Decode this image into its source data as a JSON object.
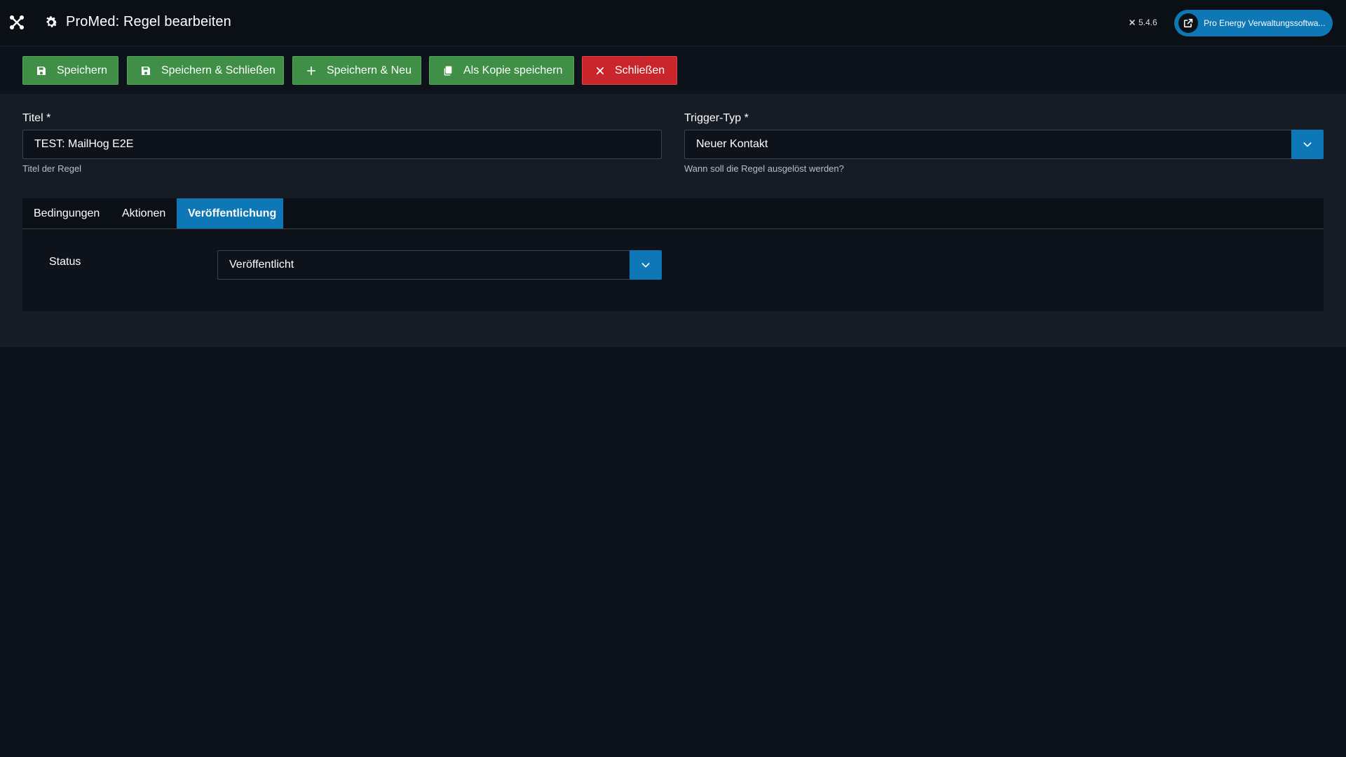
{
  "header": {
    "title": "ProMed: Regel bearbeiten",
    "version": "5.4.6",
    "site_button_label": "Pro Energy Verwaltungssoftwa..."
  },
  "toolbar": {
    "save_label": "Speichern",
    "save_close_label": "Speichern & Schließen",
    "save_new_label": "Speichern & Neu",
    "save_copy_label": "Als Kopie speichern",
    "close_label": "Schließen"
  },
  "form": {
    "title_label": "Titel *",
    "title_value": "TEST: MailHog E2E",
    "title_help": "Titel der Regel",
    "trigger_label": "Trigger-Typ *",
    "trigger_value": "Neuer Kontakt",
    "trigger_help": "Wann soll die Regel ausgelöst werden?"
  },
  "tabs": [
    {
      "label": "Bedingungen",
      "active": false
    },
    {
      "label": "Aktionen",
      "active": false
    },
    {
      "label": "Veröffentlichung",
      "active": true
    }
  ],
  "publishing": {
    "status_label": "Status",
    "status_value": "Veröffentlicht"
  },
  "colors": {
    "accent": "#0d78b5",
    "success": "#3f8f47",
    "danger": "#c9252b",
    "background": "#0e131b"
  },
  "icons": {
    "logo": "joomla-logo-icon",
    "title": "gear-icon",
    "site": "external-link-icon",
    "save": "floppy-disk-icon",
    "save_new": "plus-icon",
    "copy": "copy-icon",
    "close": "x-icon",
    "select": "chevron-down-icon"
  }
}
